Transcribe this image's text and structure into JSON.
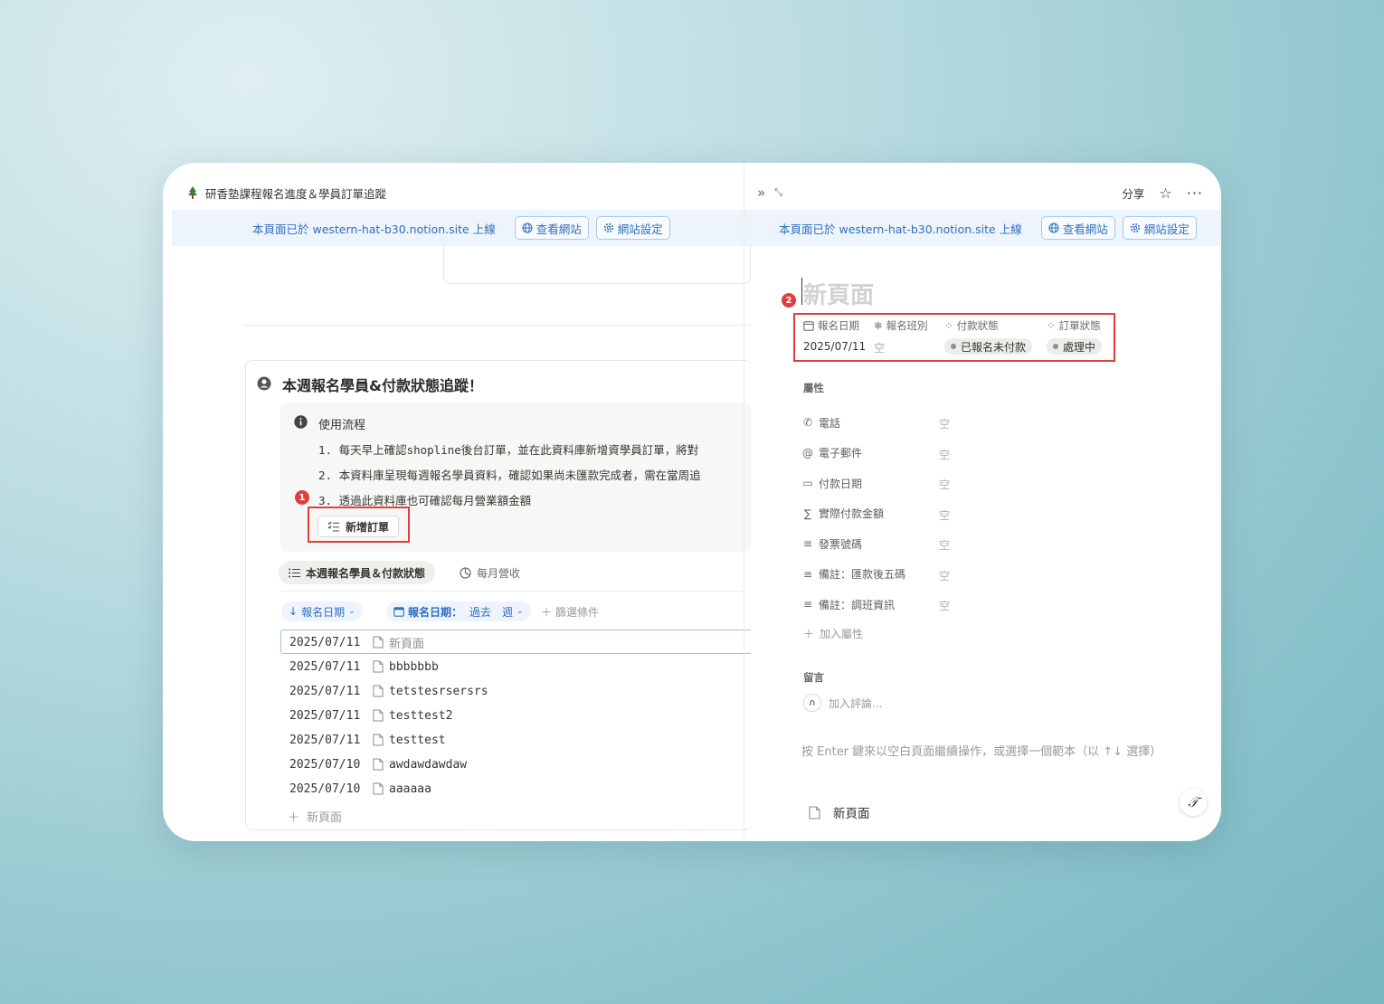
{
  "left": {
    "title": "研香塾課程報名進度＆學員訂單追蹤",
    "banner": {
      "text": "本頁面已於 western-hat-b30.notion.site 上線",
      "view_site": "查看網站",
      "site_settings": "網站設定"
    },
    "section_heading": "本週報名學員&付款狀態追蹤！",
    "callout": {
      "title": "使用流程",
      "steps": [
        "1. 每天早上確認shopline後台訂單，並在此資料庫新增資學員訂單，將對",
        "2. 本資料庫呈現每週報名學員資料，確認如果尚未匯款完成者，需在當周追",
        "3. 透過此資料庫也可確認每月營業額金額"
      ],
      "button": "新增訂單",
      "badge": "1"
    },
    "tabs": [
      "本週報名學員＆付款狀態",
      "每月營收"
    ],
    "filters": {
      "sort": "報名日期",
      "filter_label": "報名日期：",
      "filter_value": "過去",
      "filter_unit": "週",
      "add_filter": "篩選條件"
    },
    "rows": [
      {
        "date": "2025/07/11",
        "name": "新頁面"
      },
      {
        "date": "2025/07/11",
        "name": "bbbbbbb"
      },
      {
        "date": "2025/07/11",
        "name": "tetstesrsersrs"
      },
      {
        "date": "2025/07/11",
        "name": "testtest2"
      },
      {
        "date": "2025/07/11",
        "name": "testtest"
      },
      {
        "date": "2025/07/10",
        "name": "awdawdawdaw"
      },
      {
        "date": "2025/07/10",
        "name": "aaaaaa"
      }
    ],
    "new_page": "新頁面"
  },
  "right": {
    "share": "分享",
    "banner": {
      "text": "本頁面已於 western-hat-b30.notion.site 上線",
      "view_site": "查看網站",
      "site_settings": "網站設定"
    },
    "page_title_placeholder": "新頁面",
    "badge": "2",
    "summary": {
      "headers": [
        "報名日期",
        "報名班別",
        "付款狀態",
        "訂單狀態"
      ],
      "date": "2025/07/11",
      "empty": "空",
      "payment_status": "已報名未付款",
      "order_status": "處理中"
    },
    "properties_title": "屬性",
    "properties": [
      {
        "label": "電話",
        "icon": "phone-icon",
        "value": "空"
      },
      {
        "label": "電子郵件",
        "icon": "at-icon",
        "value": "空"
      },
      {
        "label": "付款日期",
        "icon": "calendar-icon",
        "value": "空"
      },
      {
        "label": "實際付款金額",
        "icon": "formula-icon",
        "value": "空"
      },
      {
        "label": "發票號碼",
        "icon": "text-icon",
        "value": "空"
      },
      {
        "label": "備註：匯款後五碼",
        "icon": "text-icon",
        "value": "空"
      },
      {
        "label": "備註：調班資訊",
        "icon": "text-icon",
        "value": "空"
      }
    ],
    "add_property": "加入屬性",
    "comments_title": "留言",
    "add_comment": "加入評論...",
    "hint": "按 Enter 鍵來以空白頁面繼續操作，或選擇一個範本（以 ↑↓ 選擇）",
    "template_new_page": "新頁面"
  }
}
